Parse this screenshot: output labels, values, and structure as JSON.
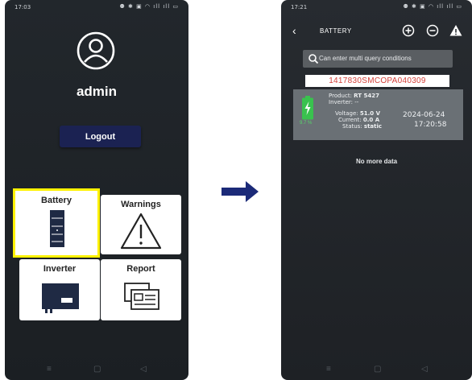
{
  "left_screen": {
    "status_time": "17:03",
    "status_icons": "⚉ ✱ ▣ ◠ ıll ıll ▭",
    "username": "admin",
    "logout_label": "Logout",
    "tiles": [
      {
        "label": "Battery",
        "icon": "battery-cabinet-icon",
        "highlighted": true
      },
      {
        "label": "Warnings",
        "icon": "warning-triangle-icon"
      },
      {
        "label": "Inverter",
        "icon": "inverter-icon"
      },
      {
        "label": "Report",
        "icon": "report-cards-icon"
      }
    ],
    "highlight_color": "#fff200",
    "nav": [
      "≡",
      "▢",
      "◁"
    ]
  },
  "transition_arrow_color": "#1b2a78",
  "right_screen": {
    "status_time": "17:21",
    "status_icons": "⚉ ✱ ▣ ◠ ıll ıll ▭",
    "title": "BATTERY",
    "back": "‹",
    "search_placeholder": "Can enter multi query conditions",
    "serial": "1417830SMCOPA040309",
    "card": {
      "product_label": "Product:",
      "product_value": "RT 5427",
      "inverter_label": "Inverter:",
      "inverter_value": "--",
      "voltage_label": "Voltage:",
      "voltage_value": "51.0 V",
      "current_label": "Current:",
      "current_value": "0.0 A",
      "status_label": "Status:",
      "status_value": "static",
      "date": "2024-06-24",
      "time": "17:20:58",
      "soc": "9.7 %",
      "soc_color": "#39c24e"
    },
    "empty_text": "No more data",
    "nav": [
      "≡",
      "▢",
      "◁"
    ]
  }
}
